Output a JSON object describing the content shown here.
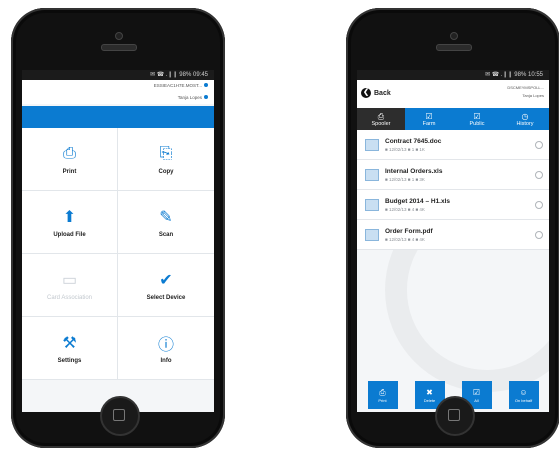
{
  "left_phone": {
    "status_time": "09:45",
    "status_icons": "✉ ☎ .❙❙ 98%",
    "info_line1": "ESSIEAC1H7E.MOST...",
    "info_line2": "Tanja Lopes",
    "tiles": [
      {
        "label": "Print",
        "icon": "printer-icon",
        "glyph": "⎙",
        "enabled": true
      },
      {
        "label": "Copy",
        "icon": "copy-icon",
        "glyph": "⎘",
        "enabled": true
      },
      {
        "label": "Upload File",
        "icon": "upload-icon",
        "glyph": "⬆",
        "enabled": true
      },
      {
        "label": "Scan",
        "icon": "scan-icon",
        "glyph": "✎",
        "enabled": true
      },
      {
        "label": "Card Association",
        "icon": "card-reader-icon",
        "glyph": "▭",
        "enabled": false
      },
      {
        "label": "Select Device",
        "icon": "check-circle-icon",
        "glyph": "✔",
        "enabled": true
      },
      {
        "label": "Settings",
        "icon": "settings-icon",
        "glyph": "⚒",
        "enabled": true
      },
      {
        "label": "Info",
        "icon": "info-icon",
        "glyph": "ⓘ",
        "enabled": true
      }
    ]
  },
  "right_phone": {
    "status_time": "10:55",
    "back_label": "Back",
    "info_line1": "DSCMEYMSPOLL...",
    "info_line2": "Tanja Lopes",
    "tabs": [
      {
        "label": "Spooler",
        "glyph": "⎙",
        "active": true
      },
      {
        "label": "Farm",
        "glyph": "☑",
        "active": false
      },
      {
        "label": "Public",
        "glyph": "☑",
        "active": false
      },
      {
        "label": "History",
        "glyph": "◷",
        "active": false
      }
    ],
    "documents": [
      {
        "name": "Contract 7645.doc",
        "meta": "■ 12/02/13 ■ 1 ■ 1K"
      },
      {
        "name": "Internal Orders.xls",
        "meta": "■ 12/02/13 ■ 1 ■ 3K"
      },
      {
        "name": "Budget 2014 – H1.xls",
        "meta": "■ 12/02/13 ■ 4 ■ 4K"
      },
      {
        "name": "Order Form.pdf",
        "meta": "■ 12/02/13 ■ 4 ■ 4K"
      }
    ],
    "bottom_buttons": [
      {
        "label": "Print",
        "glyph": "⎙"
      },
      {
        "label": "Delete",
        "glyph": "✖"
      },
      {
        "label": "All",
        "glyph": "☑"
      },
      {
        "label": "On behalf",
        "glyph": "☺"
      }
    ]
  },
  "colors": {
    "accent": "#0b7bd1",
    "tab_active": "#2d2d2d",
    "disabled": "#c2c8ce"
  }
}
